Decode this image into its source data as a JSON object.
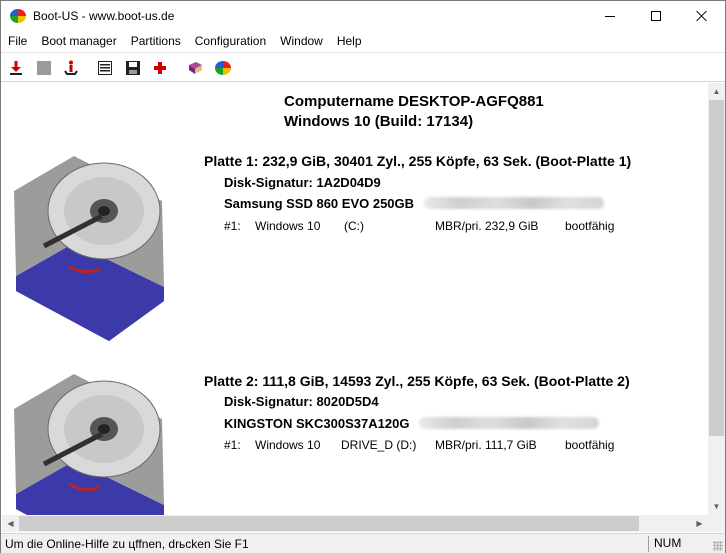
{
  "window": {
    "title": "Boot-US - www.boot-us.de"
  },
  "menu": [
    "File",
    "Boot manager",
    "Partitions",
    "Configuration",
    "Window",
    "Help"
  ],
  "toolbar": {
    "icons": [
      "install-icon",
      "stop-icon",
      "info-icon",
      "list-icon",
      "save-icon",
      "add-icon",
      "book-icon",
      "logo-icon"
    ]
  },
  "content": {
    "computer_name": "Computername DESKTOP-AGFQ881",
    "os": "Windows 10 (Build: 17134)",
    "disks": [
      {
        "title": "Platte 1:  232,9 GiB,  30401 Zyl., 255 Köpfe, 63 Sek. (Boot-Platte 1)",
        "signature": "Disk-Signatur:  1A2D04D9",
        "model": "Samsung SSD 860 EVO 250GB",
        "partitions": [
          {
            "num": "#1:",
            "name": "Windows 10",
            "drive": "(C:)",
            "type": "MBR/pri.  232,9 GiB",
            "status": "bootfähig"
          }
        ]
      },
      {
        "title": "Platte 2:  111,8 GiB,  14593 Zyl., 255 Köpfe, 63 Sek. (Boot-Platte 2)",
        "signature": "Disk-Signatur:  8020D5D4",
        "model": "KINGSTON SKC300S37A120G",
        "partitions": [
          {
            "num": "#1:",
            "name": "Windows 10",
            "drive": "DRIVE_D (D:)",
            "type": "MBR/pri.  111,7 GiB",
            "status": "bootfähig"
          }
        ]
      }
    ]
  },
  "status": {
    "hint": "Um die Online-Hilfe zu цffnen, drьcken Sie F1",
    "num": "NUM"
  },
  "colors": {
    "accent_red": "#cc0000",
    "disk_blue": "#3b3aa8"
  }
}
